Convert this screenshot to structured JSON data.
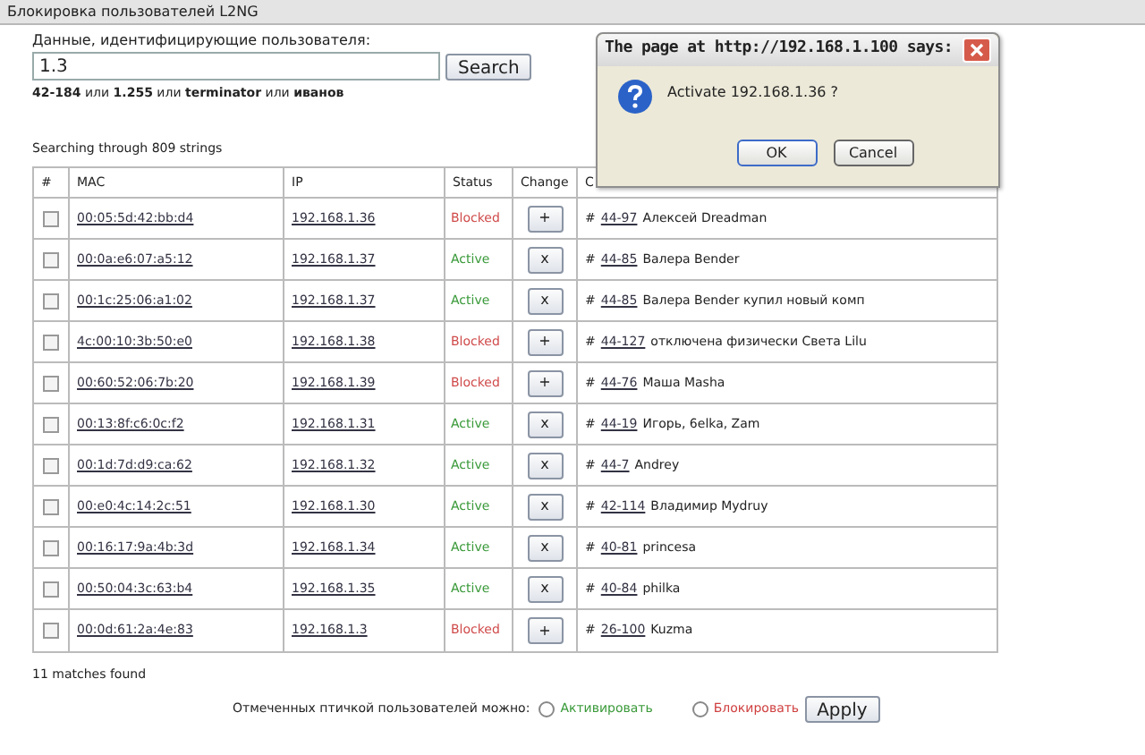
{
  "window": {
    "title": "Блокировка пользователей L2NG"
  },
  "search": {
    "label": "Данные, идентифицирующие пользователя:",
    "value": "1.3",
    "button": "Search",
    "hint": "**42-184** или **1.255** или **terminator** или **иванов**"
  },
  "summary": "Searching through 809 strings",
  "table": {
    "columns": [
      "#",
      "MAC",
      "IP",
      "Status",
      "Change",
      "C"
    ],
    "rows": [
      {
        "checked": false,
        "mac": "00:05:5d:42:bb:d4",
        "ip": "192.168.1.36",
        "status": "Blocked",
        "blocked": true,
        "change": "+",
        "mark": "#",
        "ref": "44-97",
        "comment": "Алексей Dreadman"
      },
      {
        "checked": false,
        "mac": "00:0a:e6:07:a5:12",
        "ip": "192.168.1.37",
        "status": "Active",
        "blocked": false,
        "change": "x",
        "mark": "#",
        "ref": "44-85",
        "comment": "Валера Bender"
      },
      {
        "checked": false,
        "mac": "00:1c:25:06:a1:02",
        "ip": "192.168.1.37",
        "status": "Active",
        "blocked": false,
        "change": "x",
        "mark": "#",
        "ref": "44-85",
        "comment": "Валера Bender купил новый комп"
      },
      {
        "checked": false,
        "mac": "4c:00:10:3b:50:e0",
        "ip": "192.168.1.38",
        "status": "Blocked",
        "blocked": true,
        "change": "+",
        "mark": "#",
        "ref": "44-127",
        "comment": "отключена физически Света Lilu"
      },
      {
        "checked": false,
        "mac": "00:60:52:06:7b:20",
        "ip": "192.168.1.39",
        "status": "Blocked",
        "blocked": true,
        "change": "+",
        "mark": "#",
        "ref": "44-76",
        "comment": "Маша Masha"
      },
      {
        "checked": false,
        "mac": "00:13:8f:c6:0c:f2",
        "ip": "192.168.1.31",
        "status": "Active",
        "blocked": false,
        "change": "x",
        "mark": "#",
        "ref": "44-19",
        "comment": "Игорь, 6elka, Zam"
      },
      {
        "checked": false,
        "mac": "00:1d:7d:d9:ca:62",
        "ip": "192.168.1.32",
        "status": "Active",
        "blocked": false,
        "change": "x",
        "mark": "#",
        "ref": "44-7",
        "comment": "Andrey"
      },
      {
        "checked": false,
        "mac": "00:e0:4c:14:2c:51",
        "ip": "192.168.1.30",
        "status": "Active",
        "blocked": false,
        "change": "x",
        "mark": "#",
        "ref": "42-114",
        "comment": "Владимир Mydruy"
      },
      {
        "checked": false,
        "mac": "00:16:17:9a:4b:3d",
        "ip": "192.168.1.34",
        "status": "Active",
        "blocked": false,
        "change": "x",
        "mark": "#",
        "ref": "40-81",
        "comment": "princesa"
      },
      {
        "checked": false,
        "mac": "00:50:04:3c:63:b4",
        "ip": "192.168.1.35",
        "status": "Active",
        "blocked": false,
        "change": "x",
        "mark": "#",
        "ref": "40-84",
        "comment": "philka"
      },
      {
        "checked": false,
        "mac": "00:0d:61:2a:4e:83",
        "ip": "192.168.1.3",
        "status": "Blocked",
        "blocked": true,
        "change": "+",
        "mark": "#",
        "ref": "26-100",
        "comment": "Kuzma"
      }
    ]
  },
  "matches": "11 matches found",
  "bulk": {
    "label": "Отмеченных птичкой пользователей можно:",
    "options": [
      {
        "label": "Активировать",
        "kind": "activate",
        "selected": false
      },
      {
        "label": "Блокировать",
        "kind": "block",
        "selected": false
      }
    ],
    "button": "Apply"
  },
  "dialog": {
    "title": "The page at http://192.168.1.100 says:",
    "message": "Activate 192.168.1.36 ?",
    "buttons": [
      "OK",
      "Cancel"
    ]
  }
}
